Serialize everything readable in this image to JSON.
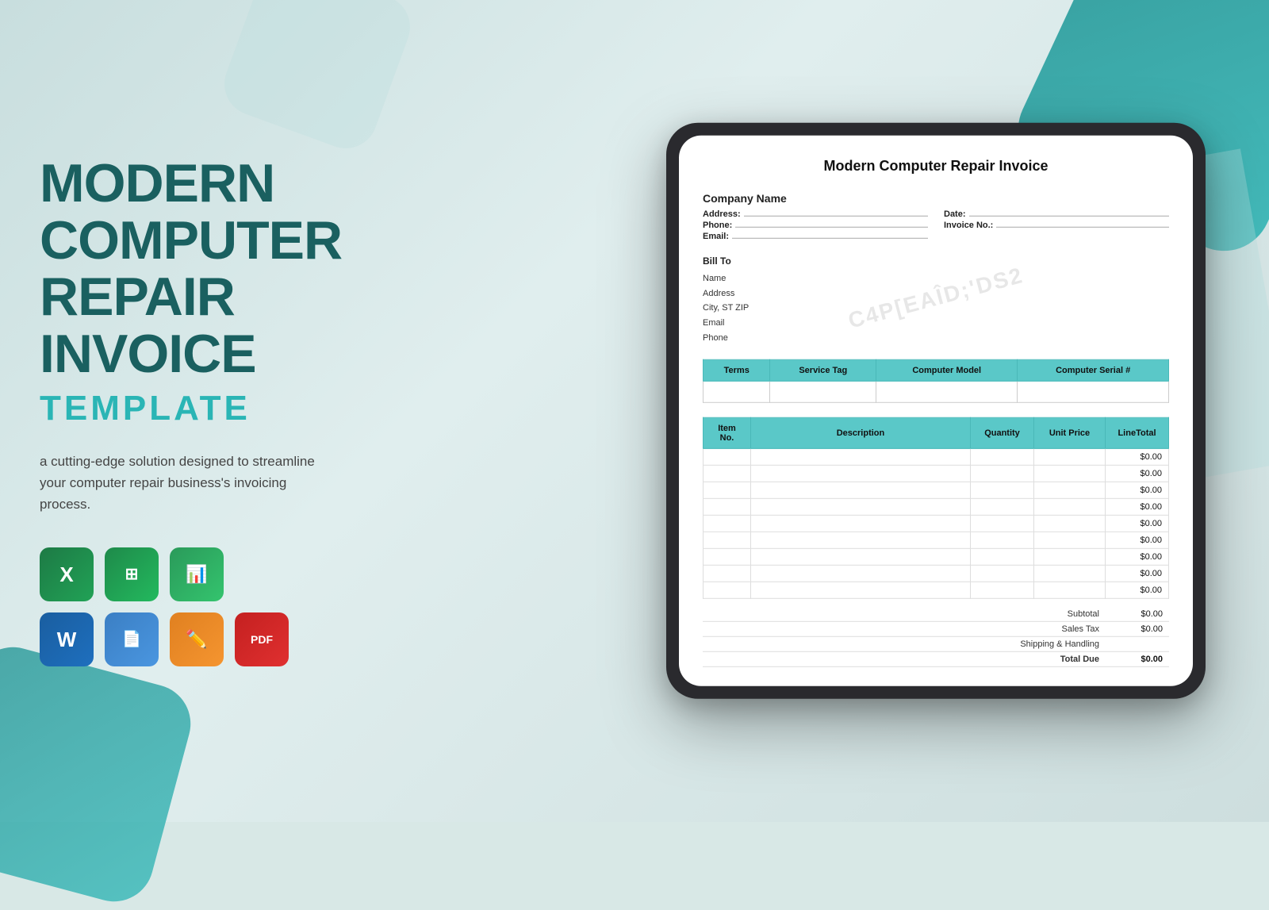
{
  "background": {
    "color": "#d0e5e5"
  },
  "left": {
    "main_title": "MODERN\nCOMPUTER\nREPAIR\nINVOICE",
    "sub_title": "TEMPLATE",
    "description": "a cutting-edge solution designed to streamline your computer repair business's invoicing process.",
    "icons": [
      {
        "id": "excel",
        "letter": "X",
        "sub": "",
        "color_class": "excel"
      },
      {
        "id": "gsheets",
        "letter": "≡",
        "sub": "",
        "color_class": "gsheets"
      },
      {
        "id": "numbers",
        "letter": "▦",
        "sub": "",
        "color_class": "numbers"
      },
      {
        "id": "word",
        "letter": "W",
        "sub": "",
        "color_class": "word"
      },
      {
        "id": "gdocs",
        "letter": "≡",
        "sub": "",
        "color_class": "gdocs"
      },
      {
        "id": "pages",
        "letter": "✏",
        "sub": "",
        "color_class": "pages"
      },
      {
        "id": "pdf",
        "letter": "PDF",
        "sub": "",
        "color_class": "pdf"
      }
    ]
  },
  "invoice": {
    "title": "Modern Computer Repair Invoice",
    "company_name": "Company Name",
    "fields": {
      "address_label": "Address:",
      "phone_label": "Phone:",
      "email_label": "Email:",
      "date_label": "Date:",
      "invoice_no_label": "Invoice No.:"
    },
    "bill_to": {
      "title": "Bill To",
      "name": "Name",
      "address": "Address",
      "city": "City, ST ZIP",
      "email": "Email",
      "phone": "Phone"
    },
    "watermark": "C4P[EAÎD;'DS2",
    "service_table": {
      "headers": [
        "Terms",
        "Service Tag",
        "Computer Model",
        "Computer Serial #"
      ],
      "row": [
        "",
        "",
        "",
        ""
      ]
    },
    "items_table": {
      "headers": [
        "Item No.",
        "Description",
        "Quantity",
        "Unit Price",
        "LineTotal"
      ],
      "rows": [
        {
          "item": "",
          "desc": "",
          "qty": "",
          "unit": "",
          "total": "$0.00"
        },
        {
          "item": "",
          "desc": "",
          "qty": "",
          "unit": "",
          "total": "$0.00"
        },
        {
          "item": "",
          "desc": "",
          "qty": "",
          "unit": "",
          "total": "$0.00"
        },
        {
          "item": "",
          "desc": "",
          "qty": "",
          "unit": "",
          "total": "$0.00"
        },
        {
          "item": "",
          "desc": "",
          "qty": "",
          "unit": "",
          "total": "$0.00"
        },
        {
          "item": "",
          "desc": "",
          "qty": "",
          "unit": "",
          "total": "$0.00"
        },
        {
          "item": "",
          "desc": "",
          "qty": "",
          "unit": "",
          "total": "$0.00"
        },
        {
          "item": "",
          "desc": "",
          "qty": "",
          "unit": "",
          "total": "$0.00"
        },
        {
          "item": "",
          "desc": "",
          "qty": "",
          "unit": "",
          "total": "$0.00"
        }
      ]
    },
    "totals": {
      "subtotal_label": "Subtotal",
      "subtotal_value": "$0.00",
      "sales_tax_label": "Sales Tax",
      "sales_tax_value": "$0.00",
      "shipping_label": "Shipping & Handling",
      "shipping_value": "",
      "total_due_label": "Total Due",
      "total_due_value": "$0.00"
    }
  }
}
